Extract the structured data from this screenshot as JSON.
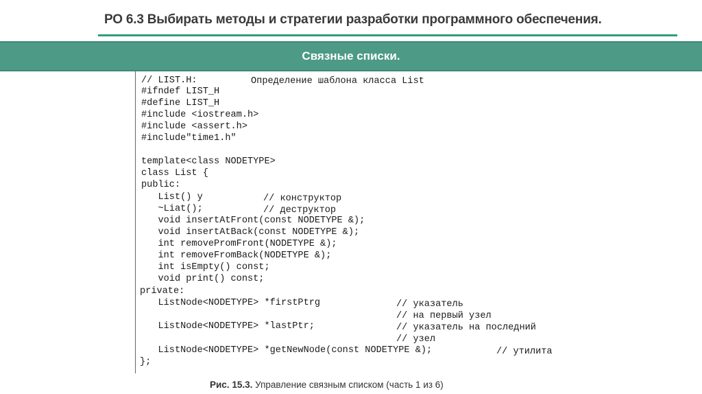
{
  "header": {
    "title": "РО 6.3 Выбирать методы и стратегии разработки программного обеспечения.",
    "banner": "Связные списки.",
    "accent_color": "#4d9a86",
    "rule_color": "#2f9e7a"
  },
  "code": {
    "lines": [
      "// LIST.H:",
      "#ifndef LIST_H",
      "#define LIST_H",
      "#include <iostream.h>",
      "#include <assert.h>",
      "#include\"time1.h\"",
      "",
      "template<class NODETYPE>",
      "class List {",
      "public:",
      "   List() y",
      "   ~Liat();",
      "   void insertAtFront(const NODETYPE &);",
      "   void insertAtBack(const NODETYPE &);",
      "   int removePromFront(NODETYPE &);",
      "   int removeFromBack(NODETYPE &);",
      "   int isEmpty() const;",
      "   void print() const;",
      "private:",
      "   ListNode<NODETYPE> *firstPtrg",
      "",
      "   ListNode<NODETYPE> *lastPtr;",
      "",
      "   ListNode<NODETYPE> *getNewNode(const NODETYPE &);",
      "};"
    ],
    "comments": {
      "header_note": "Определение шаблона класса List",
      "ctor": "// конструктор",
      "dtor": "// деструктор",
      "first_1": "// указатель",
      "first_2": "// на первый узел",
      "last_1": "// указатель на последний",
      "last_2": "// узел",
      "util": "// утилита"
    }
  },
  "caption": {
    "figure": "Рис. 15.3.",
    "text": " Управление связным списком (часть 1 из 6)"
  }
}
